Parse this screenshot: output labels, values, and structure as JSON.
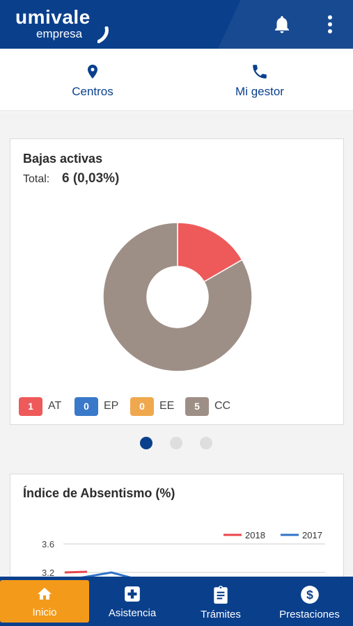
{
  "header": {
    "logo_main": "umivale",
    "logo_sub": "empresa"
  },
  "quick_links": [
    {
      "label": "Centros",
      "icon": "location-pin-icon"
    },
    {
      "label": "Mi gestor",
      "icon": "phone-icon"
    }
  ],
  "bajas": {
    "title": "Bajas activas",
    "total_label": "Total:",
    "total_value": "6 (0,03%)",
    "legend": [
      {
        "code": "AT",
        "count": "1",
        "color": "#ee5a5a"
      },
      {
        "code": "EP",
        "count": "0",
        "color": "#3a78c9"
      },
      {
        "code": "EE",
        "count": "0",
        "color": "#f0a84e"
      },
      {
        "code": "CC",
        "count": "5",
        "color": "#9e8f86"
      }
    ]
  },
  "carousel": {
    "pages": 3,
    "active": 0
  },
  "absentismo": {
    "title": "Índice de Absentismo (%)"
  },
  "chart_data": [
    {
      "type": "pie",
      "labels": [
        "AT",
        "EP",
        "EE",
        "CC"
      ],
      "values": [
        1,
        0,
        0,
        5
      ],
      "colors": [
        "#ee5a5a",
        "#3a78c9",
        "#f0a84e",
        "#9e8f86"
      ],
      "title": "Bajas activas"
    },
    {
      "type": "line",
      "title": "Índice de Absentismo (%)",
      "ytick_labels": [
        "3.6",
        "3.2"
      ],
      "legend_placement": "top-right",
      "series": [
        {
          "name": "2018",
          "color": "#e8454a",
          "values": [
            3.2,
            3.21
          ]
        },
        {
          "name": "2017",
          "color": "#2f73c8",
          "values": [
            3.11,
            3.2,
            3.13
          ]
        }
      ]
    }
  ],
  "bottom_nav": [
    {
      "label": "Inicio",
      "icon": "home-icon",
      "active": true
    },
    {
      "label": "Asistencia",
      "icon": "medical-cross-icon",
      "active": false
    },
    {
      "label": "Trámites",
      "icon": "clipboard-icon",
      "active": false
    },
    {
      "label": "Prestaciones",
      "icon": "dollar-icon",
      "active": false
    }
  ]
}
